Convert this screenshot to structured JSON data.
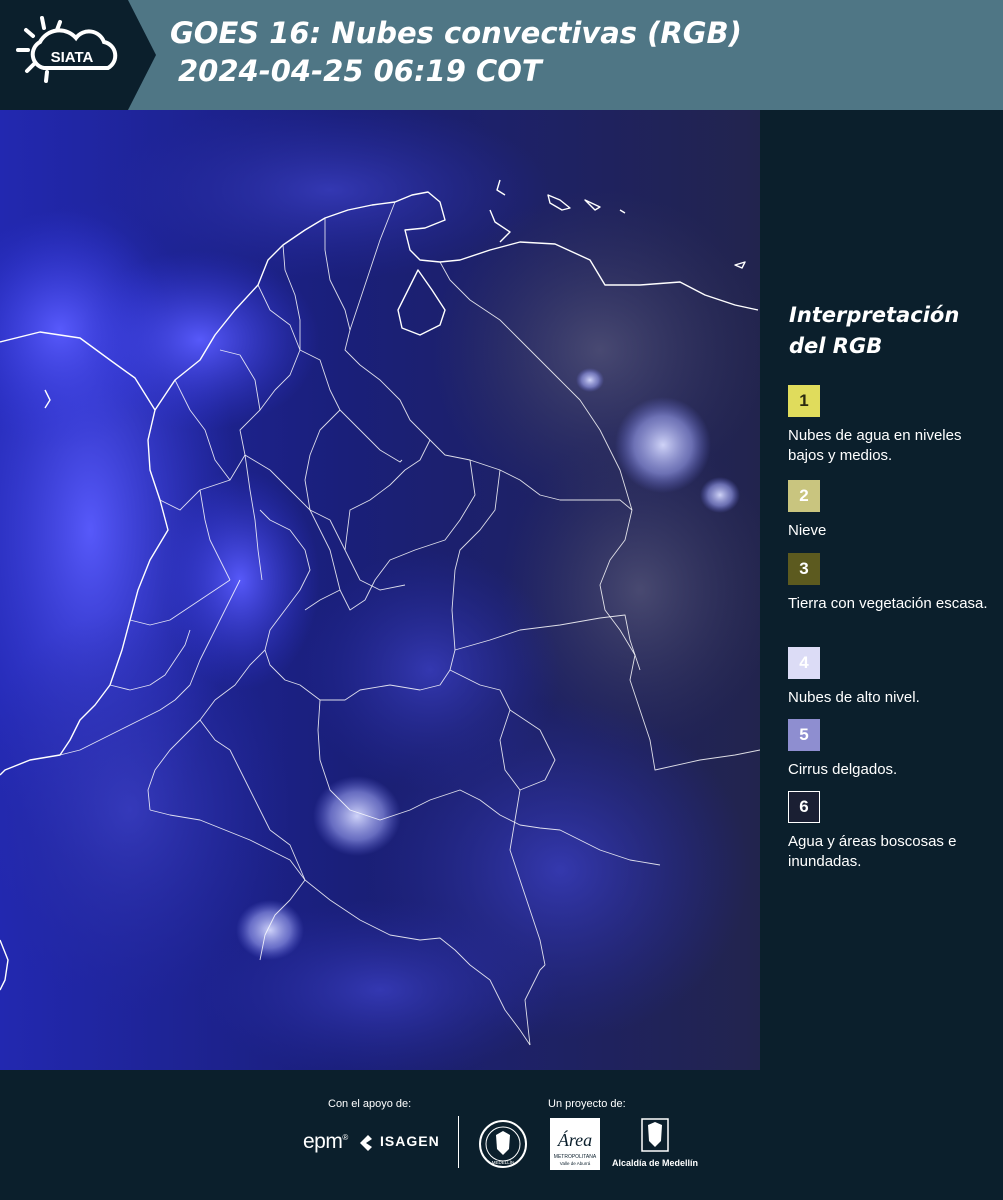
{
  "header": {
    "logo_text": "SIATA",
    "title_line1": "GOES 16: Nubes convectivas (RGB)",
    "title_line2": "2024-04-25 06:19 COT",
    "background_color": "#4f7685"
  },
  "legend": {
    "title": "Interpretación del RGB",
    "items": [
      {
        "number": "1",
        "label": "Nubes de agua en niveles bajos y medios.",
        "color": "#e0dc5c",
        "text_color": "#2a2a10"
      },
      {
        "number": "2",
        "label": "Nieve",
        "color": "#c9c57f",
        "text_color": "#ffffff"
      },
      {
        "number": "3",
        "label": "Tierra con vegetación escasa.",
        "color": "#5c5a1f",
        "text_color": "#ffffff"
      },
      {
        "number": "4",
        "label": "Nubes de alto nivel.",
        "color": "#dcdcf6",
        "text_color": "#ffffff"
      },
      {
        "number": "5",
        "label": "Cirrus delgados.",
        "color": "#8e8ed0",
        "text_color": "#ffffff"
      },
      {
        "number": "6",
        "label": "Agua y áreas boscosas e inundadas.",
        "color": "#1a1f33",
        "text_color": "#ffffff"
      }
    ]
  },
  "map": {
    "icon": "satellite-map",
    "dominant_color": "#141a5e",
    "cloud_color": "#6a70ff"
  },
  "footer": {
    "support_label": "Con el apoyo de:",
    "project_label": "Un proyecto de:",
    "sponsor_epm": "epm",
    "sponsor_isagen": "ISAGEN",
    "area_logo_text": "Área",
    "area_logo_sub1": "METROPOLITANA",
    "area_logo_sub2": "Valle de Aburrá",
    "seal_text": "MEDELLÍN",
    "alcaldia_label": "Alcaldía de Medellín"
  }
}
